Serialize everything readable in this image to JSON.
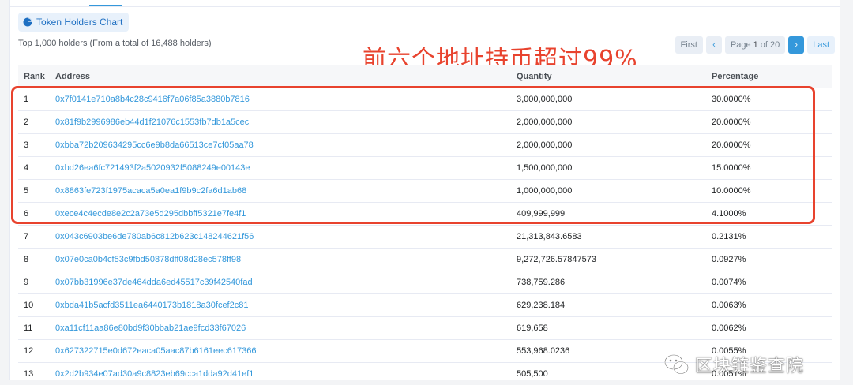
{
  "toolbar": {
    "chart_button_label": "Token Holders Chart"
  },
  "summary": "Top 1,000 holders (From a total of 16,488 holders)",
  "annotation": "前六个地址持币超过99%",
  "pager": {
    "first": "First",
    "prev": "‹",
    "page_prefix": "Page",
    "page_current": "1",
    "page_of": "of",
    "page_total": "20",
    "next": "›",
    "last": "Last"
  },
  "table": {
    "headers": {
      "rank": "Rank",
      "address": "Address",
      "quantity": "Quantity",
      "percentage": "Percentage"
    },
    "rows": [
      {
        "rank": "1",
        "address": "0x7f0141e710a8b4c28c9416f7a06f85a3880b7816",
        "quantity": "3,000,000,000",
        "percentage": "30.0000%"
      },
      {
        "rank": "2",
        "address": "0x81f9b2996986eb44d1f21076c1553fb7db1a5cec",
        "quantity": "2,000,000,000",
        "percentage": "20.0000%"
      },
      {
        "rank": "3",
        "address": "0xbba72b209634295cc6e9b8da66513ce7cf05aa78",
        "quantity": "2,000,000,000",
        "percentage": "20.0000%"
      },
      {
        "rank": "4",
        "address": "0xbd26ea6fc721493f2a5020932f5088249e00143e",
        "quantity": "1,500,000,000",
        "percentage": "15.0000%"
      },
      {
        "rank": "5",
        "address": "0x8863fe723f1975acaca5a0ea1f9b9c2fa6d1ab68",
        "quantity": "1,000,000,000",
        "percentage": "10.0000%"
      },
      {
        "rank": "6",
        "address": "0xece4c4ecde8e2c2a73e5d295dbbff5321e7fe4f1",
        "quantity": "409,999,999",
        "percentage": "4.1000%"
      },
      {
        "rank": "7",
        "address": "0x043c6903be6de780ab6c812b623c148244621f56",
        "quantity": "21,313,843.6583",
        "percentage": "0.2131%"
      },
      {
        "rank": "8",
        "address": "0x07e0ca0b4cf53c9fbd50878dff08d28ec578ff98",
        "quantity": "9,272,726.57847573",
        "percentage": "0.0927%"
      },
      {
        "rank": "9",
        "address": "0x07bb31996e37de464dda6ed45517c39f42540fad",
        "quantity": "738,759.286",
        "percentage": "0.0074%"
      },
      {
        "rank": "10",
        "address": "0xbda41b5acfd3511ea6440173b1818a30fcef2c81",
        "quantity": "629,238.184",
        "percentage": "0.0063%"
      },
      {
        "rank": "11",
        "address": "0xa11cf11aa86e80bd9f30bbab21ae9fcd33f67026",
        "quantity": "619,658",
        "percentage": "0.0062%"
      },
      {
        "rank": "12",
        "address": "0x627322715e0d672eaca05aac87b6161eec617366",
        "quantity": "553,968.0236",
        "percentage": "0.0055%"
      },
      {
        "rank": "13",
        "address": "0x2d2b934e07ad30a9c8823eb69cca1dda92d41ef1",
        "quantity": "505,500",
        "percentage": "0.0051%"
      }
    ]
  },
  "watermark": "区块链鉴查院",
  "colors": {
    "link": "#3498db",
    "annotation": "#e8432e",
    "highlight_box": "#e8432e"
  },
  "icons": {
    "chart_button": "pie-chart-icon",
    "watermark": "wechat-icon"
  }
}
